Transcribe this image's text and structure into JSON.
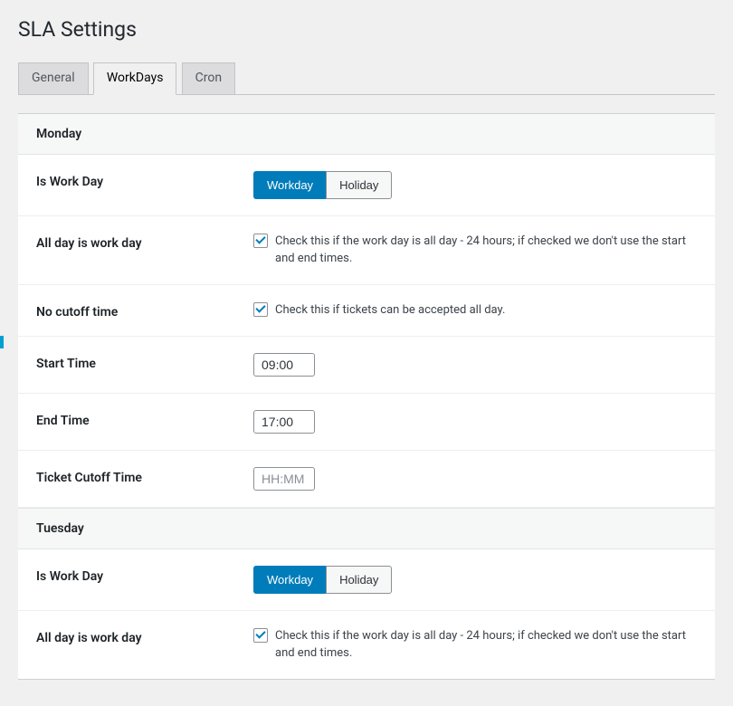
{
  "page_title": "SLA Settings",
  "tabs": [
    {
      "label": "General",
      "active": false
    },
    {
      "label": "WorkDays",
      "active": true
    },
    {
      "label": "Cron",
      "active": false
    }
  ],
  "labels": {
    "is_work_day": "Is Work Day",
    "all_day": "All day is work day",
    "no_cutoff": "No cutoff time",
    "start_time": "Start Time",
    "end_time": "End Time",
    "cutoff_time": "Ticket Cutoff Time"
  },
  "toggle": {
    "workday": "Workday",
    "holiday": "Holiday"
  },
  "descriptions": {
    "all_day": "Check this if the work day is all day - 24 hours; if checked we don't use the start and end times.",
    "no_cutoff": "Check this if tickets can be accepted all day."
  },
  "placeholders": {
    "hhmm": "HH:MM"
  },
  "days": {
    "monday": {
      "title": "Monday",
      "is_workday": true,
      "all_day_checked": true,
      "no_cutoff_checked": true,
      "start_time": "09:00",
      "end_time": "17:00",
      "cutoff_time": ""
    },
    "tuesday": {
      "title": "Tuesday",
      "is_workday": true,
      "all_day_checked": true
    }
  },
  "colors": {
    "accent": "#007cba",
    "toggle_active": "#007cba"
  }
}
